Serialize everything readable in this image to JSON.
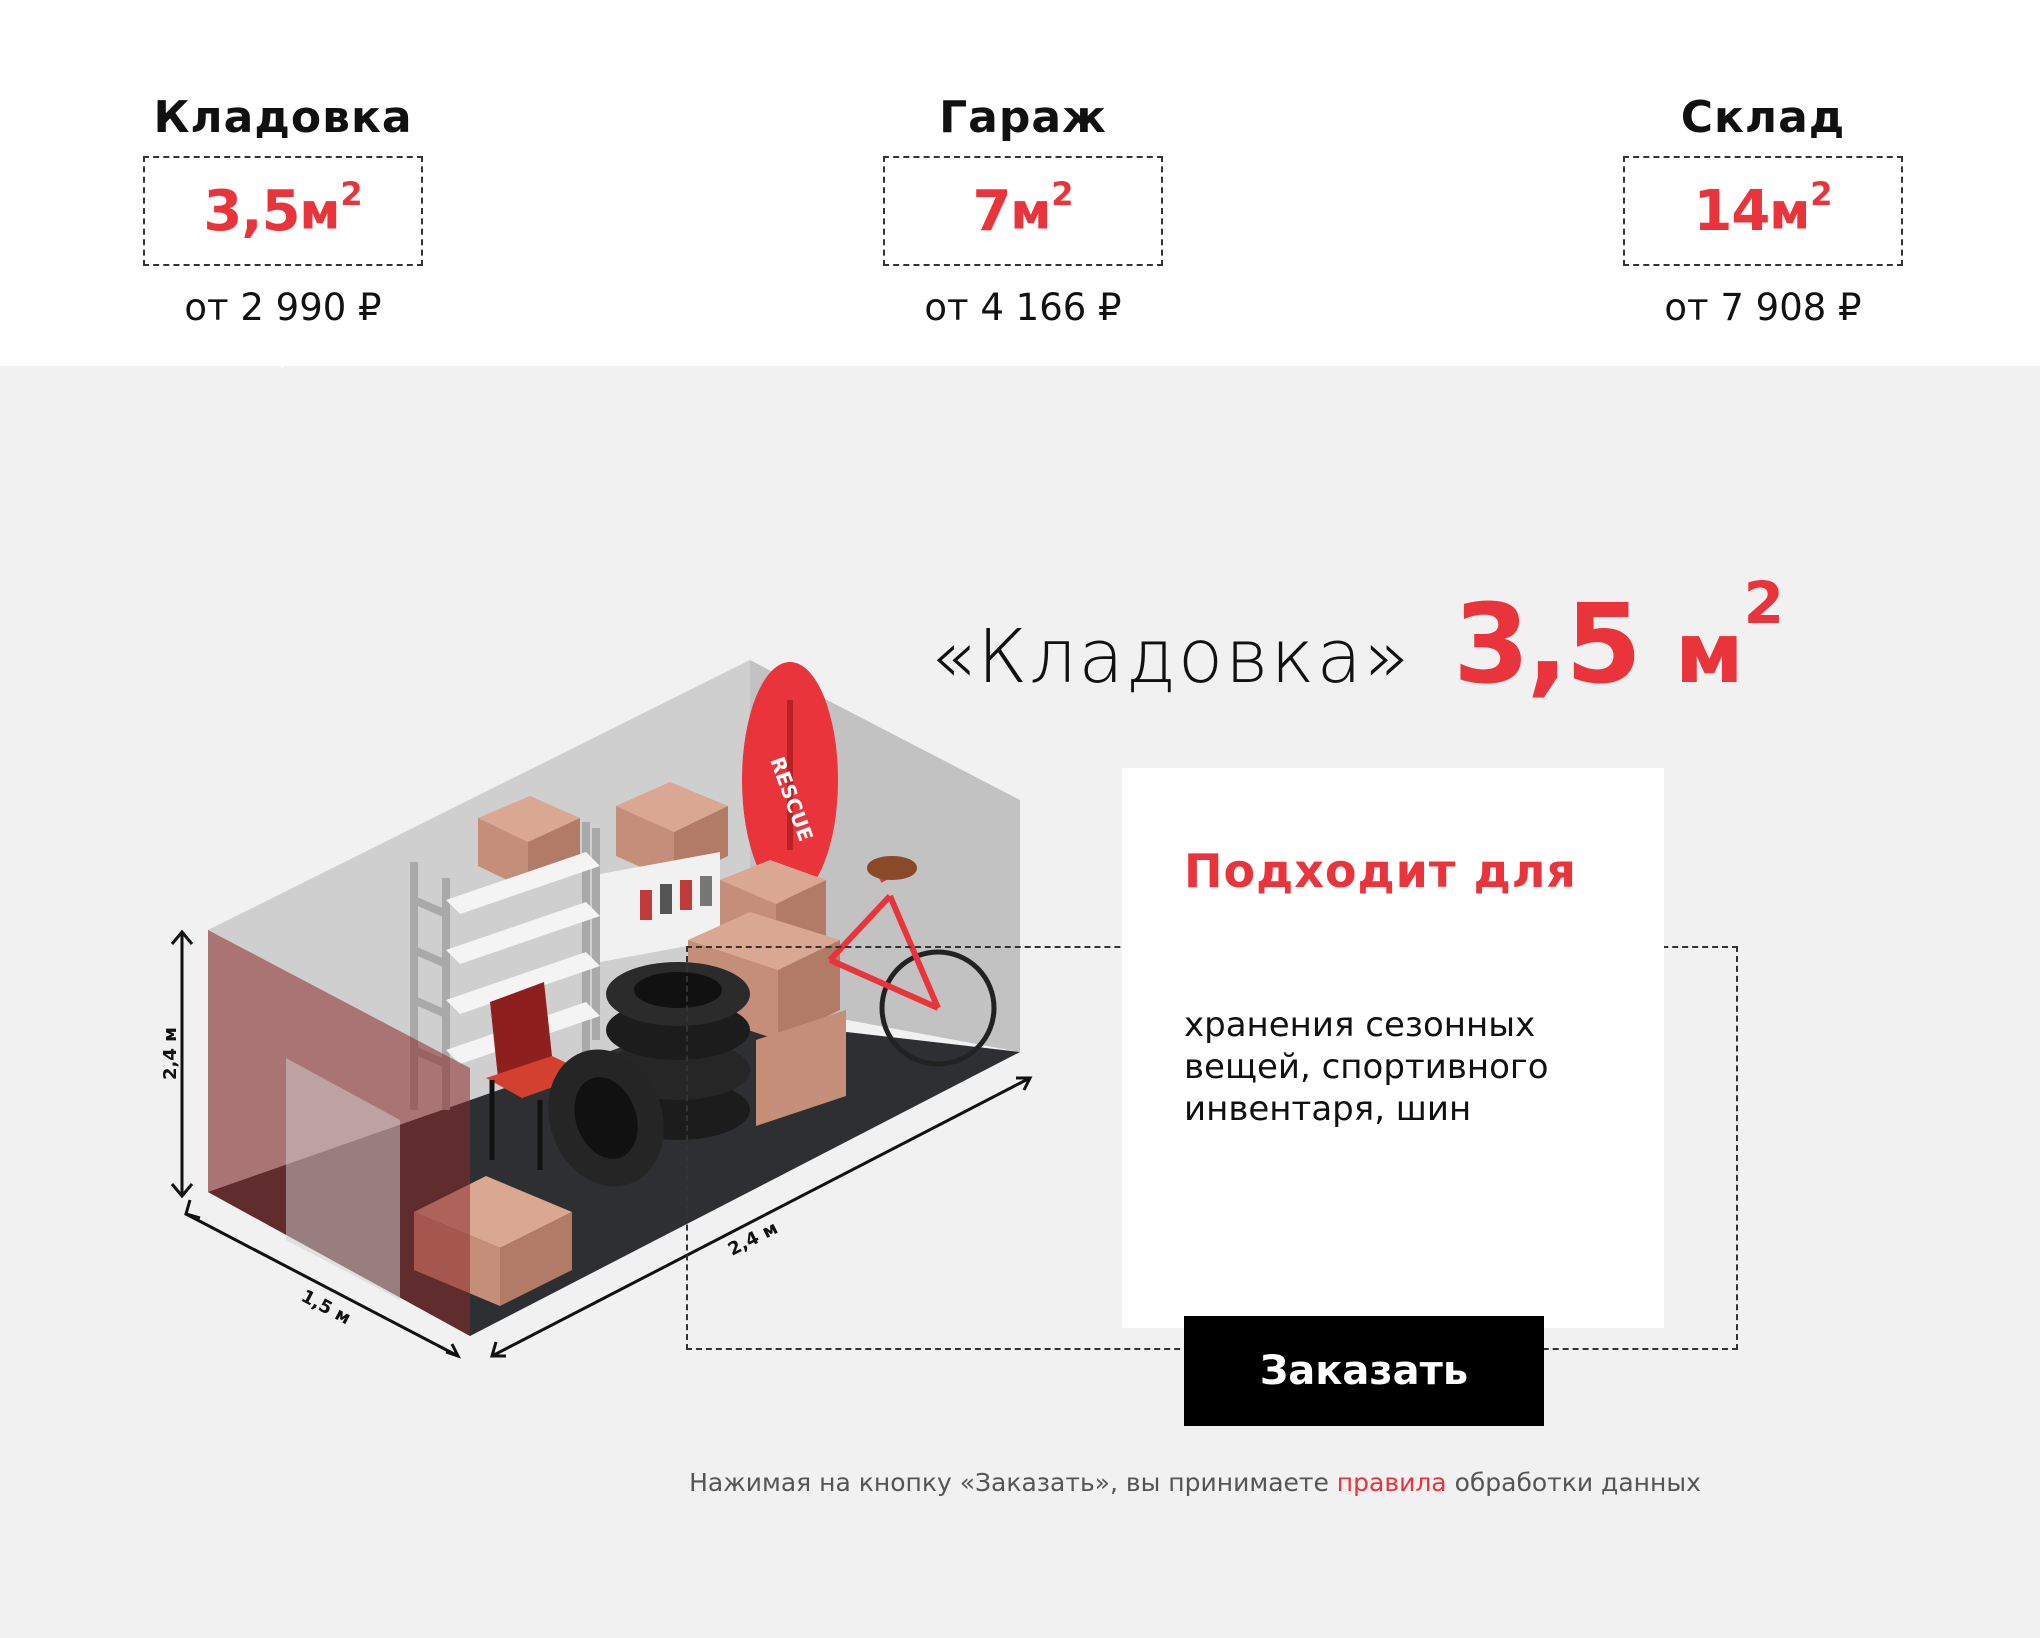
{
  "tabs": [
    {
      "title": "Кладовка",
      "area": "3,5",
      "unit": "м",
      "unit_sup": "2",
      "price": "от 2 990 ₽"
    },
    {
      "title": "Гараж",
      "area": "7",
      "unit": "м",
      "unit_sup": "2",
      "price": "от 4 166 ₽"
    },
    {
      "title": "Склад",
      "area": "14",
      "unit": "м",
      "unit_sup": "2",
      "price": "от 7 908 ₽"
    }
  ],
  "active_tab": "Кладовка",
  "heading": {
    "name": "«Кладовка»",
    "area": "3,5",
    "unit": "м",
    "unit_sup": "2"
  },
  "card": {
    "title": "Подходит для",
    "text": "хранения сезонных вещей, спортивного инвентаря, шин"
  },
  "order_button": {
    "label": "Заказать"
  },
  "consent": {
    "before": "Нажимая на кнопку «Заказать», вы принимаете ",
    "link": "правила",
    "after": " обработки данных"
  },
  "illustration": {
    "height_label": "2,4 м",
    "width_label": "1,5 м",
    "length_label": "2,4 м",
    "board_label": "RESCUE"
  },
  "colors": {
    "accent": "#e8343a",
    "background": "#f1f1f1",
    "button": "#000000"
  }
}
